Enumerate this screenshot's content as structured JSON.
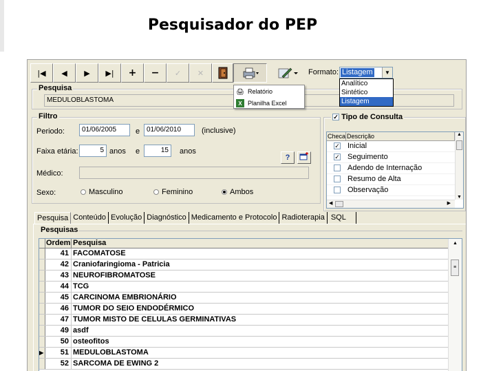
{
  "slide_title": "Pesquisador do PEP",
  "toolbar": {
    "buttons": [
      {
        "name": "first-record-button",
        "glyph": "|◀"
      },
      {
        "name": "prev-record-button",
        "glyph": "◀"
      },
      {
        "name": "next-record-button",
        "glyph": "▶"
      },
      {
        "name": "last-record-button",
        "glyph": "▶|"
      },
      {
        "name": "add-record-button",
        "glyph": "+"
      },
      {
        "name": "delete-record-button",
        "glyph": "−"
      },
      {
        "name": "confirm-button",
        "glyph": "✓"
      },
      {
        "name": "cancel-button",
        "glyph": "✕"
      },
      {
        "name": "exit-door-button",
        "glyph": "🚪"
      }
    ],
    "format_label": "Formato:",
    "format_selected": "Listagem",
    "format_options": [
      "Analítico",
      "Sintético",
      "Listagem"
    ]
  },
  "print_menu": {
    "items": [
      "Relatório",
      "Planilha Excel"
    ]
  },
  "pesquisa": {
    "title": "Pesquisa",
    "value": "MEDULOBLASTOMA"
  },
  "filtro": {
    "title": "Filtro",
    "periodo_label": "Periodo:",
    "date_from": "01/06/2005",
    "date_sep": "e",
    "date_to": "01/06/2010",
    "inclusive": "(inclusive)",
    "faixa_label": "Faixa etária:",
    "age_from": "5",
    "anos1": "anos",
    "age_sep": "e",
    "age_to": "15",
    "anos2": "anos",
    "medico_label": "Médico:",
    "medico_value": "",
    "sexo_label": "Sexo:",
    "sexo_options": [
      "Masculino",
      "Feminino",
      "Ambos"
    ],
    "sexo_selected": "Ambos",
    "help_glyph": "?"
  },
  "tipo_consulta": {
    "title": "Tipo de Consulta",
    "col_checa": "Checa",
    "col_descricao": "Descrição",
    "rows": [
      {
        "checked": true,
        "label": "Inicial"
      },
      {
        "checked": true,
        "label": "Seguimento"
      },
      {
        "checked": false,
        "label": "Adendo de Internação"
      },
      {
        "checked": false,
        "label": "Resumo de Alta"
      },
      {
        "checked": false,
        "label": "Observação"
      }
    ]
  },
  "tabs": [
    "Pesquisa",
    "Conteúdo",
    "Evolução",
    "Diagnóstico",
    "Medicamento e Protocolo",
    "Radioterapia",
    "SQL"
  ],
  "active_tab": "Pesquisa",
  "pesquisas": {
    "title": "Pesquisas",
    "col_ordem": "Ordem",
    "col_pesquisa": "Pesquisa",
    "rows": [
      {
        "ordem": "41",
        "pesquisa": "FACOMATOSE"
      },
      {
        "ordem": "42",
        "pesquisa": "Craniofaringioma - Patricia"
      },
      {
        "ordem": "43",
        "pesquisa": "NEUROFIBROMATOSE"
      },
      {
        "ordem": "44",
        "pesquisa": "TCG"
      },
      {
        "ordem": "45",
        "pesquisa": "CARCINOMA EMBRIONÁRIO"
      },
      {
        "ordem": "46",
        "pesquisa": "TUMOR DO SEIO ENDODÉRMICO"
      },
      {
        "ordem": "47",
        "pesquisa": "TUMOR MISTO DE CELULAS GERMINATIVAS"
      },
      {
        "ordem": "49",
        "pesquisa": "asdf"
      },
      {
        "ordem": "50",
        "pesquisa": "osteofitos"
      },
      {
        "ordem": "51",
        "pesquisa": "MEDULOBLASTOMA",
        "current": true
      },
      {
        "ordem": "52",
        "pesquisa": "SARCOMA DE EWING 2"
      }
    ]
  }
}
